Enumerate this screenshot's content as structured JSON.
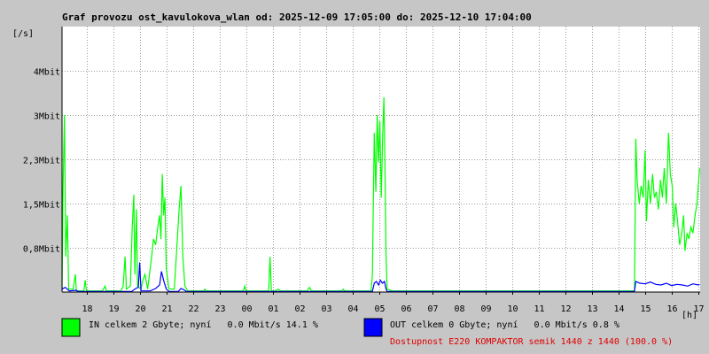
{
  "chart_data": {
    "type": "line",
    "title": "Graf provozu ost_kavulokova_wlan od: 2025-12-09 17:05:00 do: 2025-12-10 17:04:00",
    "ylabel": "[/s]",
    "xlabel": "[h]",
    "x_tick_labels": [
      "18",
      "19",
      "20",
      "21",
      "22",
      "23",
      "00",
      "01",
      "02",
      "03",
      "04",
      "05",
      "06",
      "07",
      "08",
      "09",
      "10",
      "11",
      "12",
      "13",
      "14",
      "15",
      "16",
      "17"
    ],
    "x_tick_hours": [
      18,
      19,
      20,
      21,
      22,
      23,
      24,
      25,
      26,
      27,
      28,
      29,
      30,
      31,
      32,
      33,
      34,
      35,
      36,
      37,
      38,
      39,
      40,
      41
    ],
    "xlim": [
      17.08,
      41.07
    ],
    "y_tick_labels": [
      "0,8Mbit",
      "1,5Mbit",
      "2,3Mbit",
      "3Mbit",
      "4Mbit"
    ],
    "y_tick_values": [
      0.75,
      1.5,
      2.25,
      3.0,
      3.75
    ],
    "ylim": [
      0,
      4.5
    ],
    "grid": true,
    "series": [
      {
        "name": "IN",
        "color": "#00ff00",
        "points": [
          [
            17.08,
            0.05
          ],
          [
            17.12,
            1.8
          ],
          [
            17.17,
            3.0
          ],
          [
            17.22,
            0.6
          ],
          [
            17.28,
            1.3
          ],
          [
            17.33,
            0.05
          ],
          [
            17.5,
            0.05
          ],
          [
            17.58,
            0.3
          ],
          [
            17.62,
            0.02
          ],
          [
            17.9,
            0.02
          ],
          [
            17.95,
            0.2
          ],
          [
            18.0,
            0.02
          ],
          [
            18.6,
            0.02
          ],
          [
            18.7,
            0.1
          ],
          [
            18.75,
            0.02
          ],
          [
            19.3,
            0.02
          ],
          [
            19.38,
            0.1
          ],
          [
            19.45,
            0.6
          ],
          [
            19.5,
            0.05
          ],
          [
            19.65,
            0.1
          ],
          [
            19.72,
            1.1
          ],
          [
            19.78,
            1.65
          ],
          [
            19.82,
            0.3
          ],
          [
            19.88,
            1.4
          ],
          [
            19.92,
            0.1
          ],
          [
            20.05,
            0.05
          ],
          [
            20.12,
            0.2
          ],
          [
            20.2,
            0.3
          ],
          [
            20.3,
            0.05
          ],
          [
            20.45,
            0.6
          ],
          [
            20.52,
            0.9
          ],
          [
            20.6,
            0.8
          ],
          [
            20.68,
            1.1
          ],
          [
            20.75,
            1.3
          ],
          [
            20.8,
            0.9
          ],
          [
            20.85,
            2.0
          ],
          [
            20.9,
            1.3
          ],
          [
            20.95,
            1.6
          ],
          [
            21.0,
            0.4
          ],
          [
            21.1,
            0.05
          ],
          [
            21.3,
            0.05
          ],
          [
            21.4,
            0.8
          ],
          [
            21.48,
            1.4
          ],
          [
            21.55,
            1.8
          ],
          [
            21.62,
            0.6
          ],
          [
            21.7,
            0.1
          ],
          [
            21.8,
            0.02
          ],
          [
            22.4,
            0.02
          ],
          [
            22.45,
            0.05
          ],
          [
            22.5,
            0.02
          ],
          [
            23.9,
            0.02
          ],
          [
            23.95,
            0.1
          ],
          [
            24.0,
            0.02
          ],
          [
            24.85,
            0.02
          ],
          [
            24.9,
            0.6
          ],
          [
            24.95,
            0.02
          ],
          [
            25.1,
            0.02
          ],
          [
            25.2,
            0.05
          ],
          [
            25.3,
            0.02
          ],
          [
            26.3,
            0.02
          ],
          [
            26.38,
            0.08
          ],
          [
            26.45,
            0.02
          ],
          [
            27.6,
            0.02
          ],
          [
            27.65,
            0.05
          ],
          [
            27.7,
            0.02
          ],
          [
            28.7,
            0.02
          ],
          [
            28.75,
            0.3
          ],
          [
            28.82,
            2.7
          ],
          [
            28.88,
            1.7
          ],
          [
            28.93,
            3.0
          ],
          [
            28.98,
            2.2
          ],
          [
            29.03,
            2.9
          ],
          [
            29.08,
            1.6
          ],
          [
            29.13,
            2.6
          ],
          [
            29.18,
            3.3
          ],
          [
            29.22,
            2.1
          ],
          [
            29.26,
            0.6
          ],
          [
            29.3,
            0.05
          ],
          [
            29.5,
            0.02
          ],
          [
            38.6,
            0.02
          ],
          [
            38.65,
            2.6
          ],
          [
            38.7,
            1.9
          ],
          [
            38.78,
            1.5
          ],
          [
            38.85,
            1.8
          ],
          [
            38.93,
            1.6
          ],
          [
            39.0,
            2.4
          ],
          [
            39.05,
            1.2
          ],
          [
            39.12,
            1.9
          ],
          [
            39.2,
            1.5
          ],
          [
            39.28,
            2.0
          ],
          [
            39.35,
            1.6
          ],
          [
            39.42,
            1.7
          ],
          [
            39.5,
            1.4
          ],
          [
            39.58,
            1.9
          ],
          [
            39.65,
            1.6
          ],
          [
            39.72,
            2.1
          ],
          [
            39.8,
            1.5
          ],
          [
            39.88,
            2.7
          ],
          [
            39.95,
            2.0
          ],
          [
            40.02,
            1.8
          ],
          [
            40.08,
            1.1
          ],
          [
            40.15,
            1.5
          ],
          [
            40.22,
            1.2
          ],
          [
            40.3,
            0.8
          ],
          [
            40.38,
            1.0
          ],
          [
            40.45,
            1.3
          ],
          [
            40.5,
            0.7
          ],
          [
            40.58,
            1.0
          ],
          [
            40.65,
            0.9
          ],
          [
            40.72,
            1.1
          ],
          [
            40.8,
            1.0
          ],
          [
            40.88,
            1.3
          ],
          [
            40.95,
            1.5
          ],
          [
            41.0,
            1.8
          ],
          [
            41.05,
            2.1
          ]
        ]
      },
      {
        "name": "OUT",
        "color": "#0000ff",
        "points": [
          [
            17.08,
            0.05
          ],
          [
            17.2,
            0.08
          ],
          [
            17.35,
            0.02
          ],
          [
            17.6,
            0.03
          ],
          [
            17.7,
            0.01
          ],
          [
            19.7,
            0.01
          ],
          [
            19.85,
            0.06
          ],
          [
            19.95,
            0.08
          ],
          [
            20.0,
            0.5
          ],
          [
            20.05,
            0.02
          ],
          [
            20.4,
            0.02
          ],
          [
            20.6,
            0.06
          ],
          [
            20.75,
            0.12
          ],
          [
            20.82,
            0.35
          ],
          [
            20.9,
            0.2
          ],
          [
            21.0,
            0.05
          ],
          [
            21.1,
            0.01
          ],
          [
            21.45,
            0.01
          ],
          [
            21.55,
            0.06
          ],
          [
            21.65,
            0.04
          ],
          [
            21.75,
            0.01
          ],
          [
            28.75,
            0.01
          ],
          [
            28.82,
            0.15
          ],
          [
            28.9,
            0.18
          ],
          [
            28.98,
            0.12
          ],
          [
            29.05,
            0.2
          ],
          [
            29.12,
            0.15
          ],
          [
            29.2,
            0.18
          ],
          [
            29.26,
            0.05
          ],
          [
            29.3,
            0.01
          ],
          [
            38.6,
            0.01
          ],
          [
            38.65,
            0.18
          ],
          [
            38.8,
            0.15
          ],
          [
            39.0,
            0.14
          ],
          [
            39.2,
            0.17
          ],
          [
            39.4,
            0.13
          ],
          [
            39.6,
            0.12
          ],
          [
            39.8,
            0.15
          ],
          [
            40.0,
            0.11
          ],
          [
            40.2,
            0.13
          ],
          [
            40.4,
            0.12
          ],
          [
            40.6,
            0.1
          ],
          [
            40.8,
            0.14
          ],
          [
            41.0,
            0.12
          ],
          [
            41.05,
            0.13
          ]
        ]
      }
    ]
  },
  "legend": {
    "in_text": "IN celkem 2 Gbyte; nyní   0.0 Mbit/s 14.1 %",
    "out_text": "OUT celkem 0 Gbyte; nyní   0.0 Mbit/s 0.8 %",
    "availability_text": "Dostupnost E220 KOMPAKTOR semik 1440 z 1440 (100.0 %)",
    "availability_color": "#e00000"
  }
}
